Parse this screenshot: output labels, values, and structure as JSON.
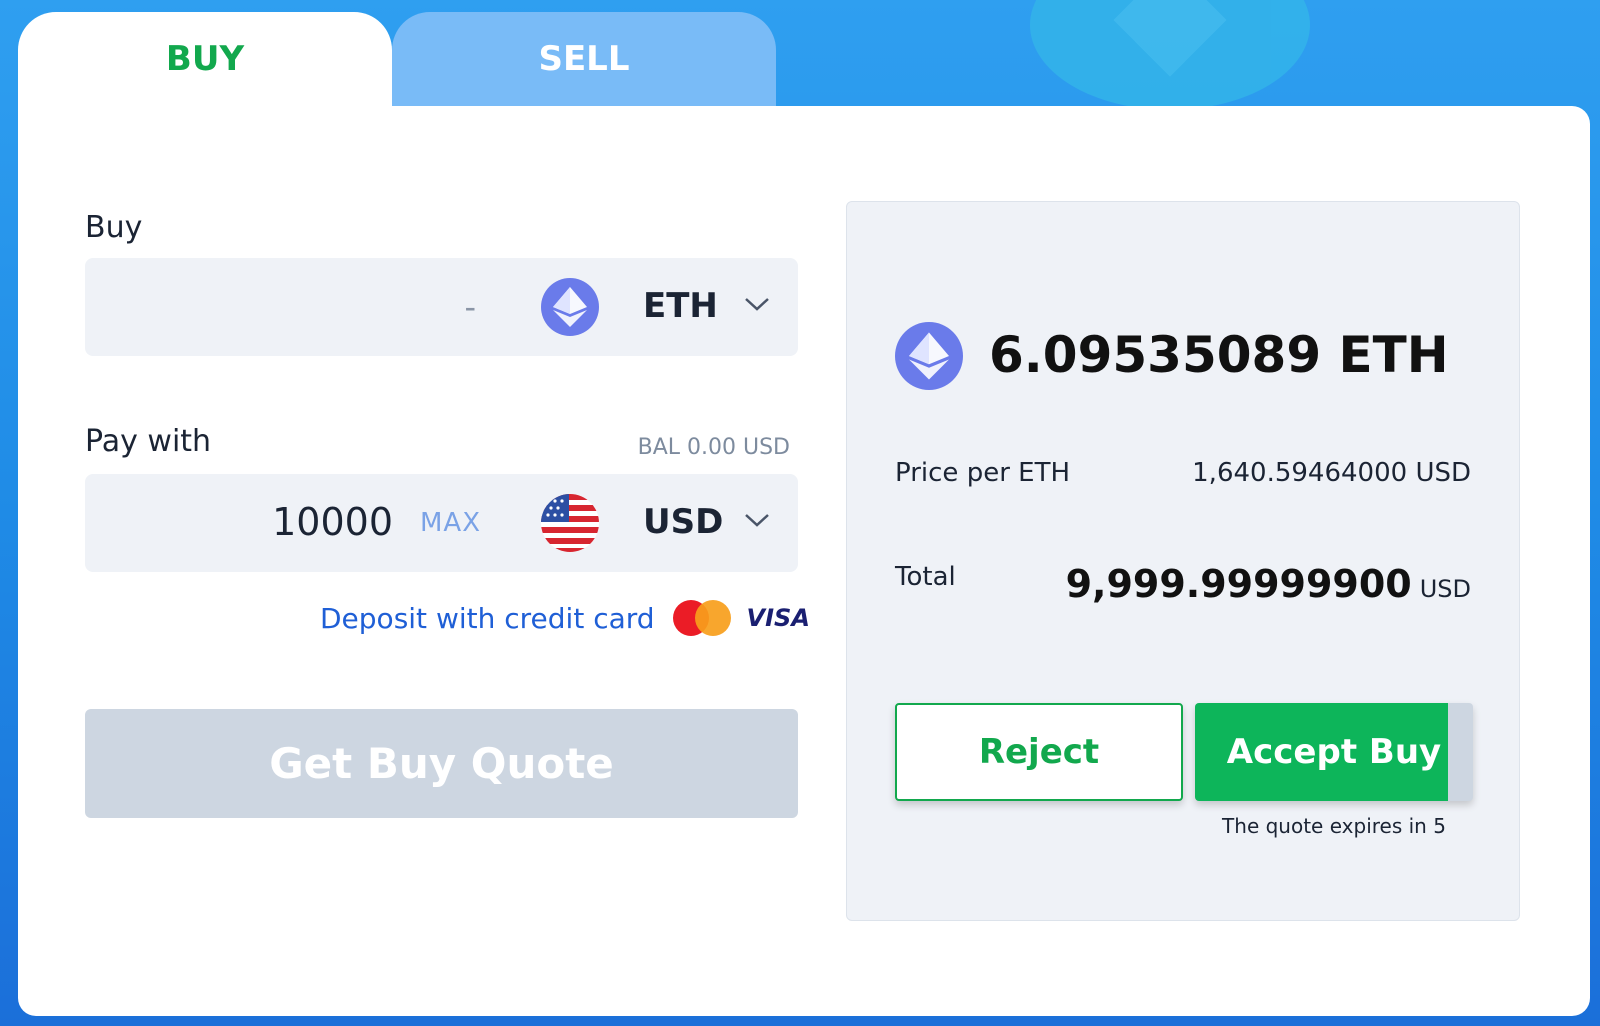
{
  "tabs": [
    {
      "label": "BUY",
      "active": true
    },
    {
      "label": "SELL",
      "active": false
    }
  ],
  "buy_form": {
    "buy_label": "Buy",
    "buy_value": "-",
    "buy_currency": "ETH",
    "pay_label": "Pay with",
    "balance": "BAL 0.00 USD",
    "pay_value": "10000",
    "max_label": "MAX",
    "pay_currency": "USD",
    "deposit_link": "Deposit with credit card",
    "visa_label": "VISA",
    "quote_button": "Get Buy Quote"
  },
  "quote": {
    "amount": "6.09535089 ETH",
    "price_label": "Price per ETH",
    "price_value": "1,640.59464000 USD",
    "total_label": "Total",
    "total_value": "9,999.99999900",
    "total_unit": "USD",
    "reject_button": "Reject",
    "accept_button": "Accept Buy",
    "accept_progress": 0.91,
    "expires_text": "The quote expires in 5"
  },
  "icons": {
    "eth": "ethereum-icon",
    "usd": "us-flag-icon",
    "chevron": "chevron-down-icon",
    "mastercard": "mastercard-icon",
    "visa": "visa-icon"
  },
  "colors": {
    "accent_green": "#12a84d",
    "link_blue": "#1f5fd6",
    "eth_purple": "#6a7bea",
    "disabled_button": "#cdd6e1"
  }
}
